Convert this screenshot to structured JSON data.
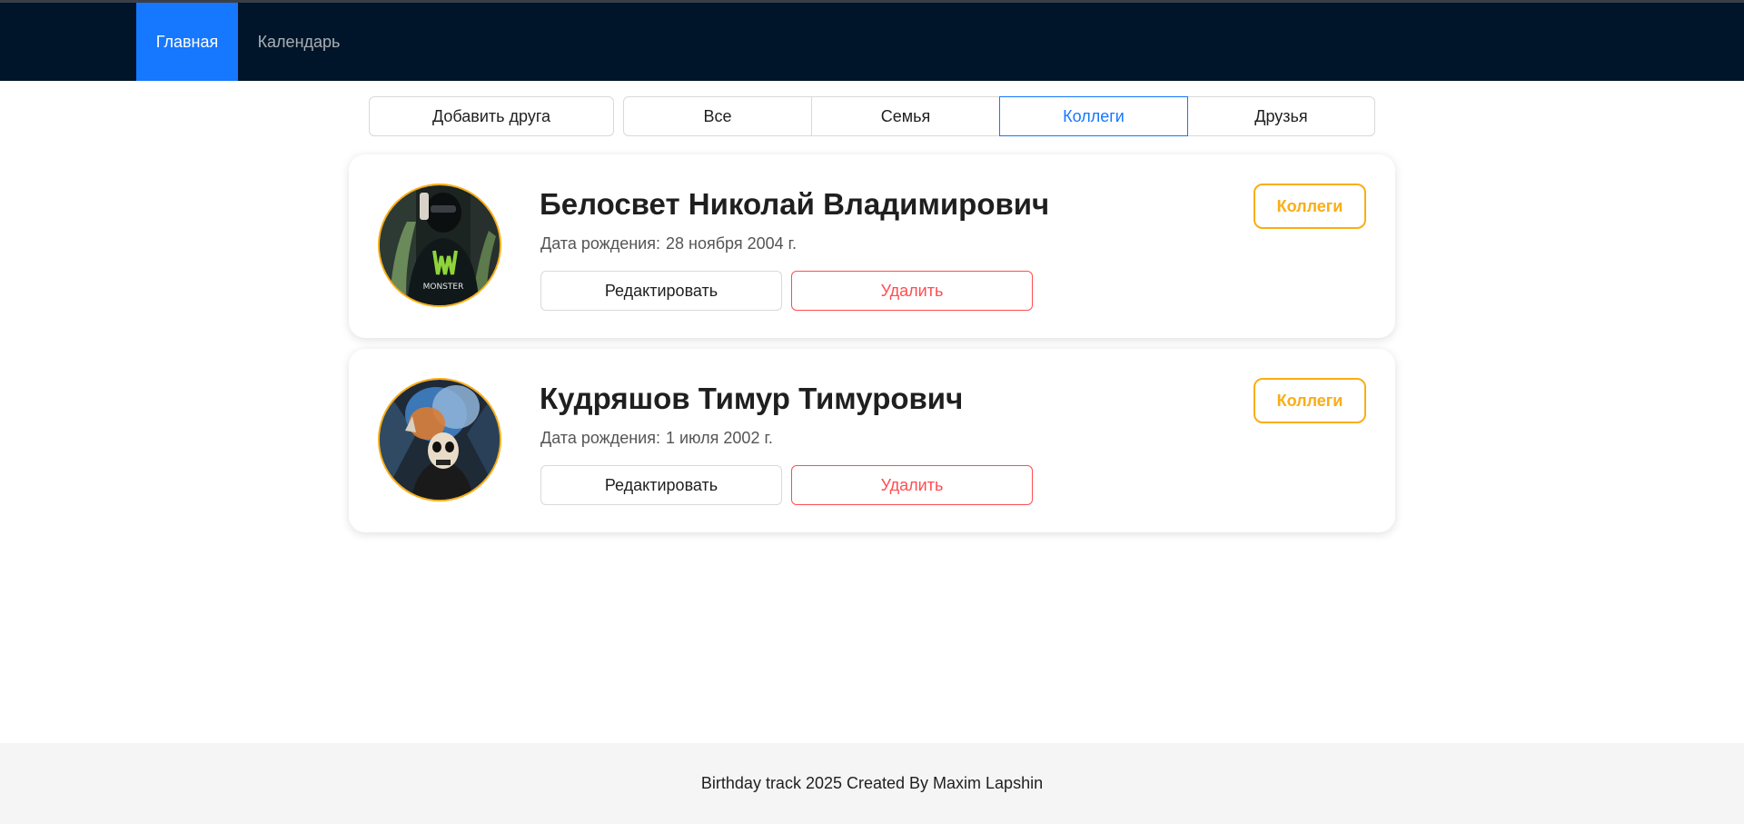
{
  "nav": {
    "items": [
      {
        "label": "Главная",
        "active": true
      },
      {
        "label": "Календарь",
        "active": false
      }
    ]
  },
  "toolbar": {
    "add_friend_label": "Добавить друга",
    "filters": [
      {
        "label": "Все",
        "selected": false
      },
      {
        "label": "Семья",
        "selected": false
      },
      {
        "label": "Коллеги",
        "selected": true
      },
      {
        "label": "Друзья",
        "selected": false
      }
    ]
  },
  "contacts": [
    {
      "name": "Белосвет Николай Владимирович",
      "dob_label": "Дата рождения:",
      "dob_value": "28 ноября 2004 г.",
      "edit_label": "Редактировать",
      "delete_label": "Удалить",
      "tag": "Коллеги"
    },
    {
      "name": "Кудряшов Тимур Тимурович",
      "dob_label": "Дата рождения:",
      "dob_value": "1 июля 2002 г.",
      "edit_label": "Редактировать",
      "delete_label": "Удалить",
      "tag": "Коллеги"
    }
  ],
  "footer": {
    "text": "Birthday track 2025 Created By Maxim Lapshin"
  },
  "colors": {
    "nav_bg": "#001529",
    "primary": "#1677ff",
    "danger": "#ff4d4f",
    "tag": "#faad14"
  }
}
